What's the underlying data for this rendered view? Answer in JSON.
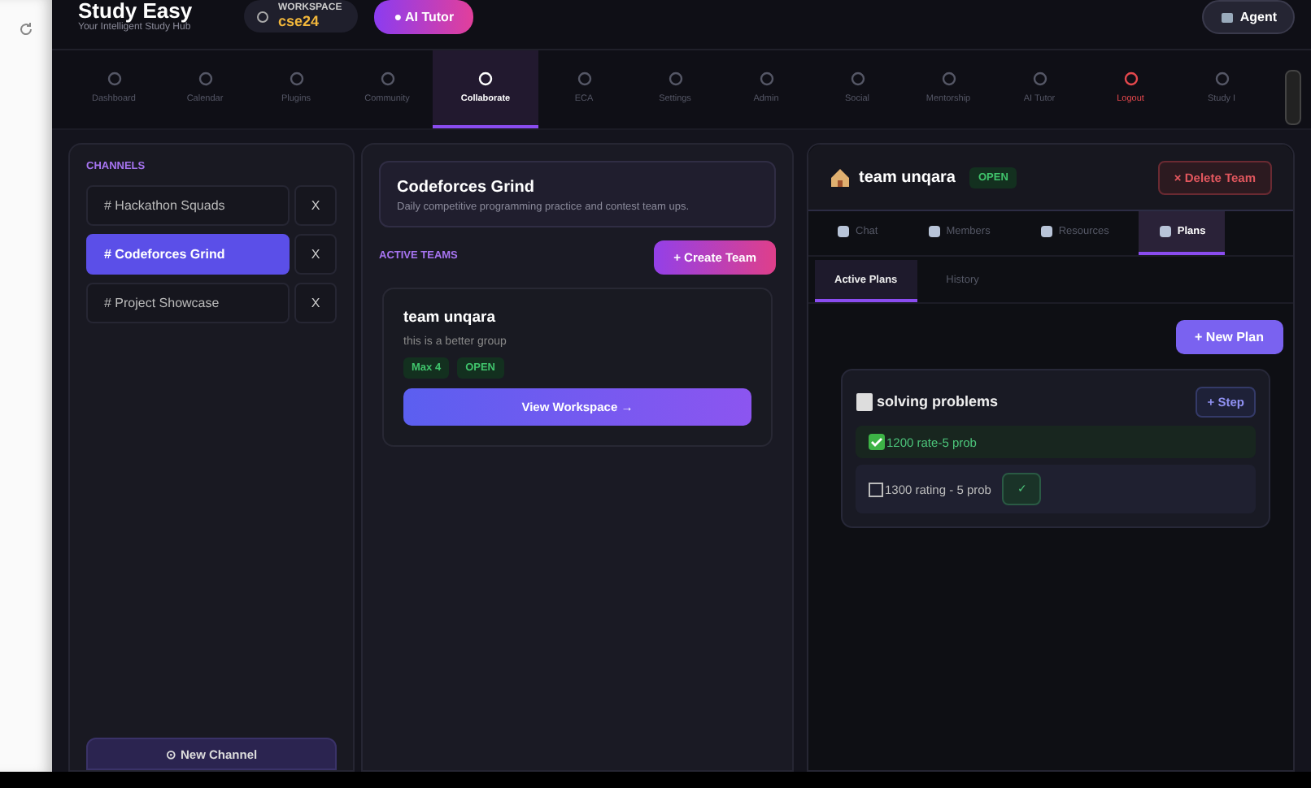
{
  "header": {
    "title": "Study Easy",
    "subtitle": "Your Intelligent Study Hub",
    "workspace": {
      "label": "WORKSPACE",
      "value": "cse24"
    },
    "ai_tutor_button": "● AI Tutor",
    "agent_button": "Agent"
  },
  "nav": [
    {
      "label": "Dashboard",
      "selected": false,
      "kind": "normal"
    },
    {
      "label": "Calendar",
      "selected": false,
      "kind": "normal"
    },
    {
      "label": "Plugins",
      "selected": false,
      "kind": "normal"
    },
    {
      "label": "Community",
      "selected": false,
      "kind": "normal"
    },
    {
      "label": "Collaborate",
      "selected": true,
      "kind": "normal"
    },
    {
      "label": "ECA",
      "selected": false,
      "kind": "normal"
    },
    {
      "label": "Settings",
      "selected": false,
      "kind": "normal"
    },
    {
      "label": "Admin",
      "selected": false,
      "kind": "normal"
    },
    {
      "label": "Social",
      "selected": false,
      "kind": "normal"
    },
    {
      "label": "Mentorship",
      "selected": false,
      "kind": "normal"
    },
    {
      "label": "AI Tutor",
      "selected": false,
      "kind": "normal"
    },
    {
      "label": "Logout",
      "selected": false,
      "kind": "danger"
    },
    {
      "label": "Study I",
      "selected": false,
      "kind": "normal"
    }
  ],
  "channels": {
    "heading": "CHANNELS",
    "items": [
      {
        "label": "# Hackathon Squads",
        "selected": false,
        "remove": "X"
      },
      {
        "label": "# Codeforces Grind",
        "selected": true,
        "remove": "X"
      },
      {
        "label": "# Project Showcase",
        "selected": false,
        "remove": "X"
      }
    ],
    "new_channel_button": "⊙ New Channel"
  },
  "group": {
    "name": "Codeforces Grind",
    "description": "Daily competitive programming practice and contest team ups."
  },
  "active_teams": {
    "heading": "ACTIVE TEAMS",
    "create_button": "+ Create Team",
    "teams": [
      {
        "name": "team unqara",
        "description": "this is a better group",
        "tags": [
          "Max 4",
          "OPEN"
        ],
        "button": "View Workspace →"
      }
    ]
  },
  "team_detail": {
    "title": "team unqara",
    "status": "OPEN",
    "delete_button": "× Delete Team",
    "tabs": [
      {
        "label": "Chat",
        "selected": false
      },
      {
        "label": "Members",
        "selected": false
      },
      {
        "label": "Resources",
        "selected": false
      },
      {
        "label": "Plans",
        "selected": true
      }
    ],
    "subtabs": [
      {
        "label": "Active Plans",
        "selected": true
      },
      {
        "label": "History",
        "selected": false
      }
    ],
    "new_plan_button": "+ New Plan",
    "plans": [
      {
        "title": "solving problems",
        "step_button": "+ Step",
        "steps": [
          {
            "label": "1200 rate-5 prob",
            "done": true
          },
          {
            "label": "1300 rating - 5 prob",
            "done": false,
            "confirm": "✓"
          }
        ]
      }
    ]
  }
}
